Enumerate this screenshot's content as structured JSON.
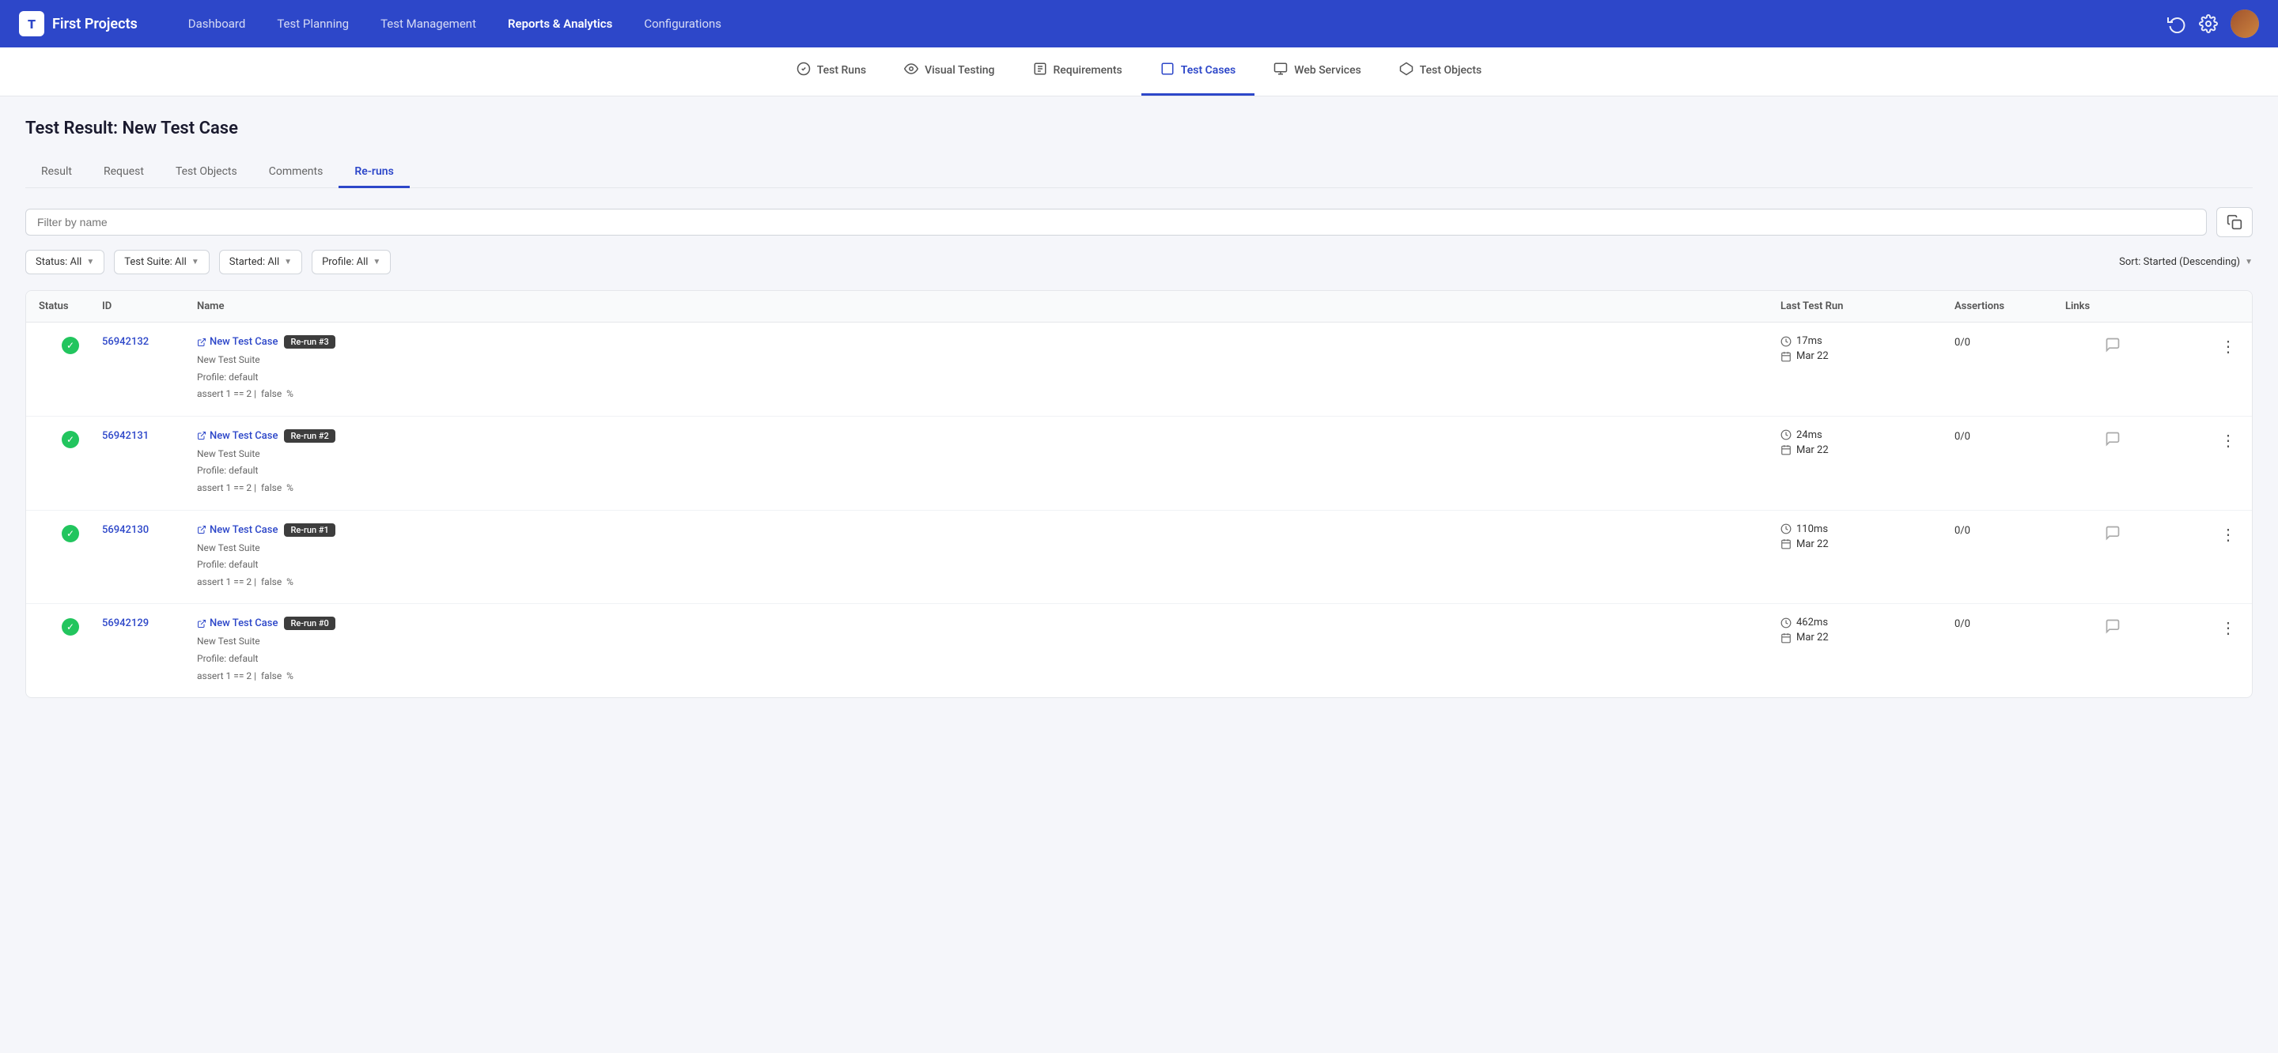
{
  "brand": {
    "icon": "T",
    "name": "First Projects"
  },
  "main_nav": {
    "items": [
      {
        "label": "Dashboard",
        "active": false
      },
      {
        "label": "Test Planning",
        "active": false
      },
      {
        "label": "Test Management",
        "active": false
      },
      {
        "label": "Reports & Analytics",
        "active": true
      },
      {
        "label": "Configurations",
        "active": false
      }
    ]
  },
  "sub_nav": {
    "items": [
      {
        "label": "Test Runs",
        "icon": "✓",
        "active": false
      },
      {
        "label": "Visual Testing",
        "icon": "◎",
        "active": false
      },
      {
        "label": "Requirements",
        "icon": "≡",
        "active": false
      },
      {
        "label": "Test Cases",
        "icon": "⬜",
        "active": true
      },
      {
        "label": "Web Services",
        "icon": "◫",
        "active": false
      },
      {
        "label": "Test Objects",
        "icon": "⬡",
        "active": false
      }
    ]
  },
  "page": {
    "title": "Test Result: New Test Case"
  },
  "tabs": [
    {
      "label": "Result",
      "active": false
    },
    {
      "label": "Request",
      "active": false
    },
    {
      "label": "Test Objects",
      "active": false
    },
    {
      "label": "Comments",
      "active": false
    },
    {
      "label": "Re-runs",
      "active": true
    }
  ],
  "search": {
    "placeholder": "Filter by name"
  },
  "filters": {
    "status": "Status: All",
    "test_suite": "Test Suite: All",
    "started": "Started: All",
    "profile": "Profile: All",
    "sort": "Sort: Started (Descending)"
  },
  "table": {
    "headers": [
      "Status",
      "ID",
      "Name",
      "Last Test Run",
      "Assertions",
      "Links",
      "",
      ""
    ],
    "rows": [
      {
        "status": "pass",
        "id": "56942132",
        "name": "New Test Case",
        "badge": "Re-run #3",
        "suite": "New Test Suite",
        "profile": "Profile: default",
        "assert_info": "assert 1 == 2 |  false  %",
        "time": "17ms",
        "date": "Mar 22",
        "assertions": "0/0"
      },
      {
        "status": "pass",
        "id": "56942131",
        "name": "New Test Case",
        "badge": "Re-run #2",
        "suite": "New Test Suite",
        "profile": "Profile: default",
        "assert_info": "assert 1 == 2 |  false  %",
        "time": "24ms",
        "date": "Mar 22",
        "assertions": "0/0"
      },
      {
        "status": "pass",
        "id": "56942130",
        "name": "New Test Case",
        "badge": "Re-run #1",
        "suite": "New Test Suite",
        "profile": "Profile: default",
        "assert_info": "assert 1 == 2 |  false  %",
        "time": "110ms",
        "date": "Mar 22",
        "assertions": "0/0"
      },
      {
        "status": "pass",
        "id": "56942129",
        "name": "New Test Case",
        "badge": "Re-run #0",
        "suite": "New Test Suite",
        "profile": "Profile: default",
        "assert_info": "assert 1 == 2 |  false  %",
        "time": "462ms",
        "date": "Mar 22",
        "assertions": "0/0"
      }
    ]
  }
}
